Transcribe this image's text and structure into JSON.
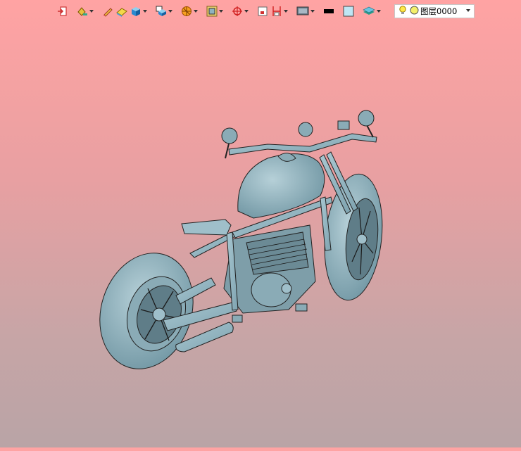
{
  "toolbar": {
    "buttons": [
      {
        "name": "exit-sketch-icon",
        "dropdown": false
      },
      {
        "name": "paint-bucket-icon",
        "dropdown": true
      },
      {
        "name": "pencil-icon",
        "dropdown": false
      },
      {
        "name": "eraser-icon",
        "dropdown": false
      },
      {
        "name": "solid-box-icon",
        "dropdown": true
      },
      {
        "name": "view-orient-icon",
        "dropdown": true
      },
      {
        "name": "section-icon",
        "dropdown": true
      },
      {
        "name": "frame-icon",
        "dropdown": true
      },
      {
        "name": "target-icon",
        "dropdown": true
      },
      {
        "name": "sheet-icon",
        "dropdown": false
      },
      {
        "name": "dimension-icon",
        "dropdown": true
      },
      {
        "name": "display-icon",
        "dropdown": true
      },
      {
        "name": "line-color-icon",
        "dropdown": false
      },
      {
        "name": "face-color-icon",
        "dropdown": false
      },
      {
        "name": "layers-icon",
        "dropdown": true
      }
    ]
  },
  "layer": {
    "current": "图层0000",
    "bulb_icon": "lightbulb-icon",
    "color_icon": "layer-color-dot-icon"
  },
  "colors": {
    "background_top": "#ffa3a3",
    "background_bottom": "#b9a4a6",
    "model_body": "#8fb3bf",
    "model_edge": "#222222"
  }
}
